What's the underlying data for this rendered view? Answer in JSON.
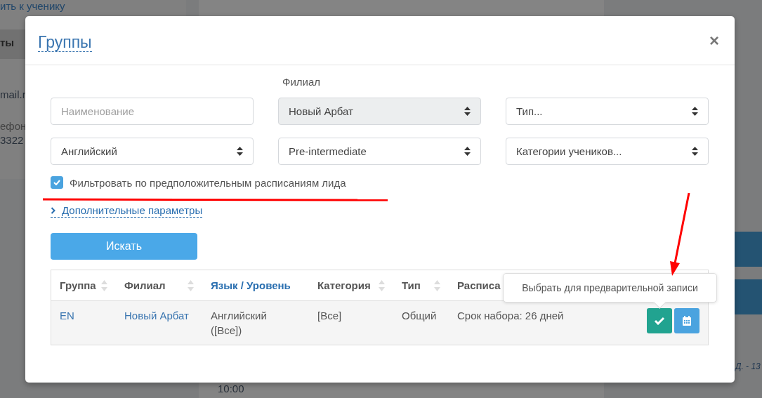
{
  "background_page": {
    "texts": [
      {
        "kind": "link",
        "text": "ить к ученику"
      },
      {
        "kind": "heading",
        "text": "ты"
      },
      {
        "kind": "plain",
        "text": "mail.r"
      },
      {
        "kind": "muted",
        "text": "ефон"
      },
      {
        "kind": "plain",
        "text": "3322"
      },
      {
        "kind": "plain",
        "text": "10:00"
      },
      {
        "kind": "italic",
        "text": "Д. - 13"
      }
    ]
  },
  "dialog": {
    "title": "Группы",
    "close": "×"
  },
  "filters": {
    "branch_label": "Филиал",
    "fields": [
      {
        "kind": "input",
        "placeholder": "Наименование",
        "disabled": false
      },
      {
        "kind": "select",
        "value": "Новый Арбат",
        "disabled": true
      },
      {
        "kind": "select",
        "value": "Тип...",
        "disabled": false
      },
      {
        "kind": "select",
        "value": "Английский",
        "disabled": false
      },
      {
        "kind": "select",
        "value": "Pre-intermediate",
        "disabled": false
      },
      {
        "kind": "select",
        "value": "Категории учеников...",
        "disabled": false
      }
    ]
  },
  "schedule_filter": {
    "label": "Фильтровать по предположительным расписаниям лида",
    "checked": true
  },
  "more_options": {
    "label": "Дополнительные параметры",
    "expanded": false
  },
  "search_button": "Искать",
  "table": {
    "columns": [
      {
        "label": "Группа",
        "sortable": true,
        "link": false
      },
      {
        "label": "Филиал",
        "sortable": true,
        "link": false
      },
      {
        "label": "Язык / Уровень",
        "sortable": false,
        "link": true
      },
      {
        "label": "Категория",
        "sortable": true,
        "link": false
      },
      {
        "label": "Тип",
        "sortable": true,
        "link": false
      },
      {
        "label": "Расписа",
        "sortable": false,
        "link": false
      }
    ],
    "rows": [
      {
        "cells": [
          {
            "text": "EN",
            "link": true
          },
          {
            "text": "Новый Арбат",
            "link": true
          },
          {
            "text": "Английский ([Все])",
            "link": false
          },
          {
            "text": "[Все]",
            "link": false
          },
          {
            "text": "Общий",
            "link": false
          },
          {
            "text": "Срок набора: 26 дней",
            "link": false
          }
        ],
        "actions": [
          {
            "kind": "select"
          },
          {
            "kind": "calendar"
          }
        ]
      }
    ]
  },
  "tooltip": "Выбрать для предварительной записи"
}
